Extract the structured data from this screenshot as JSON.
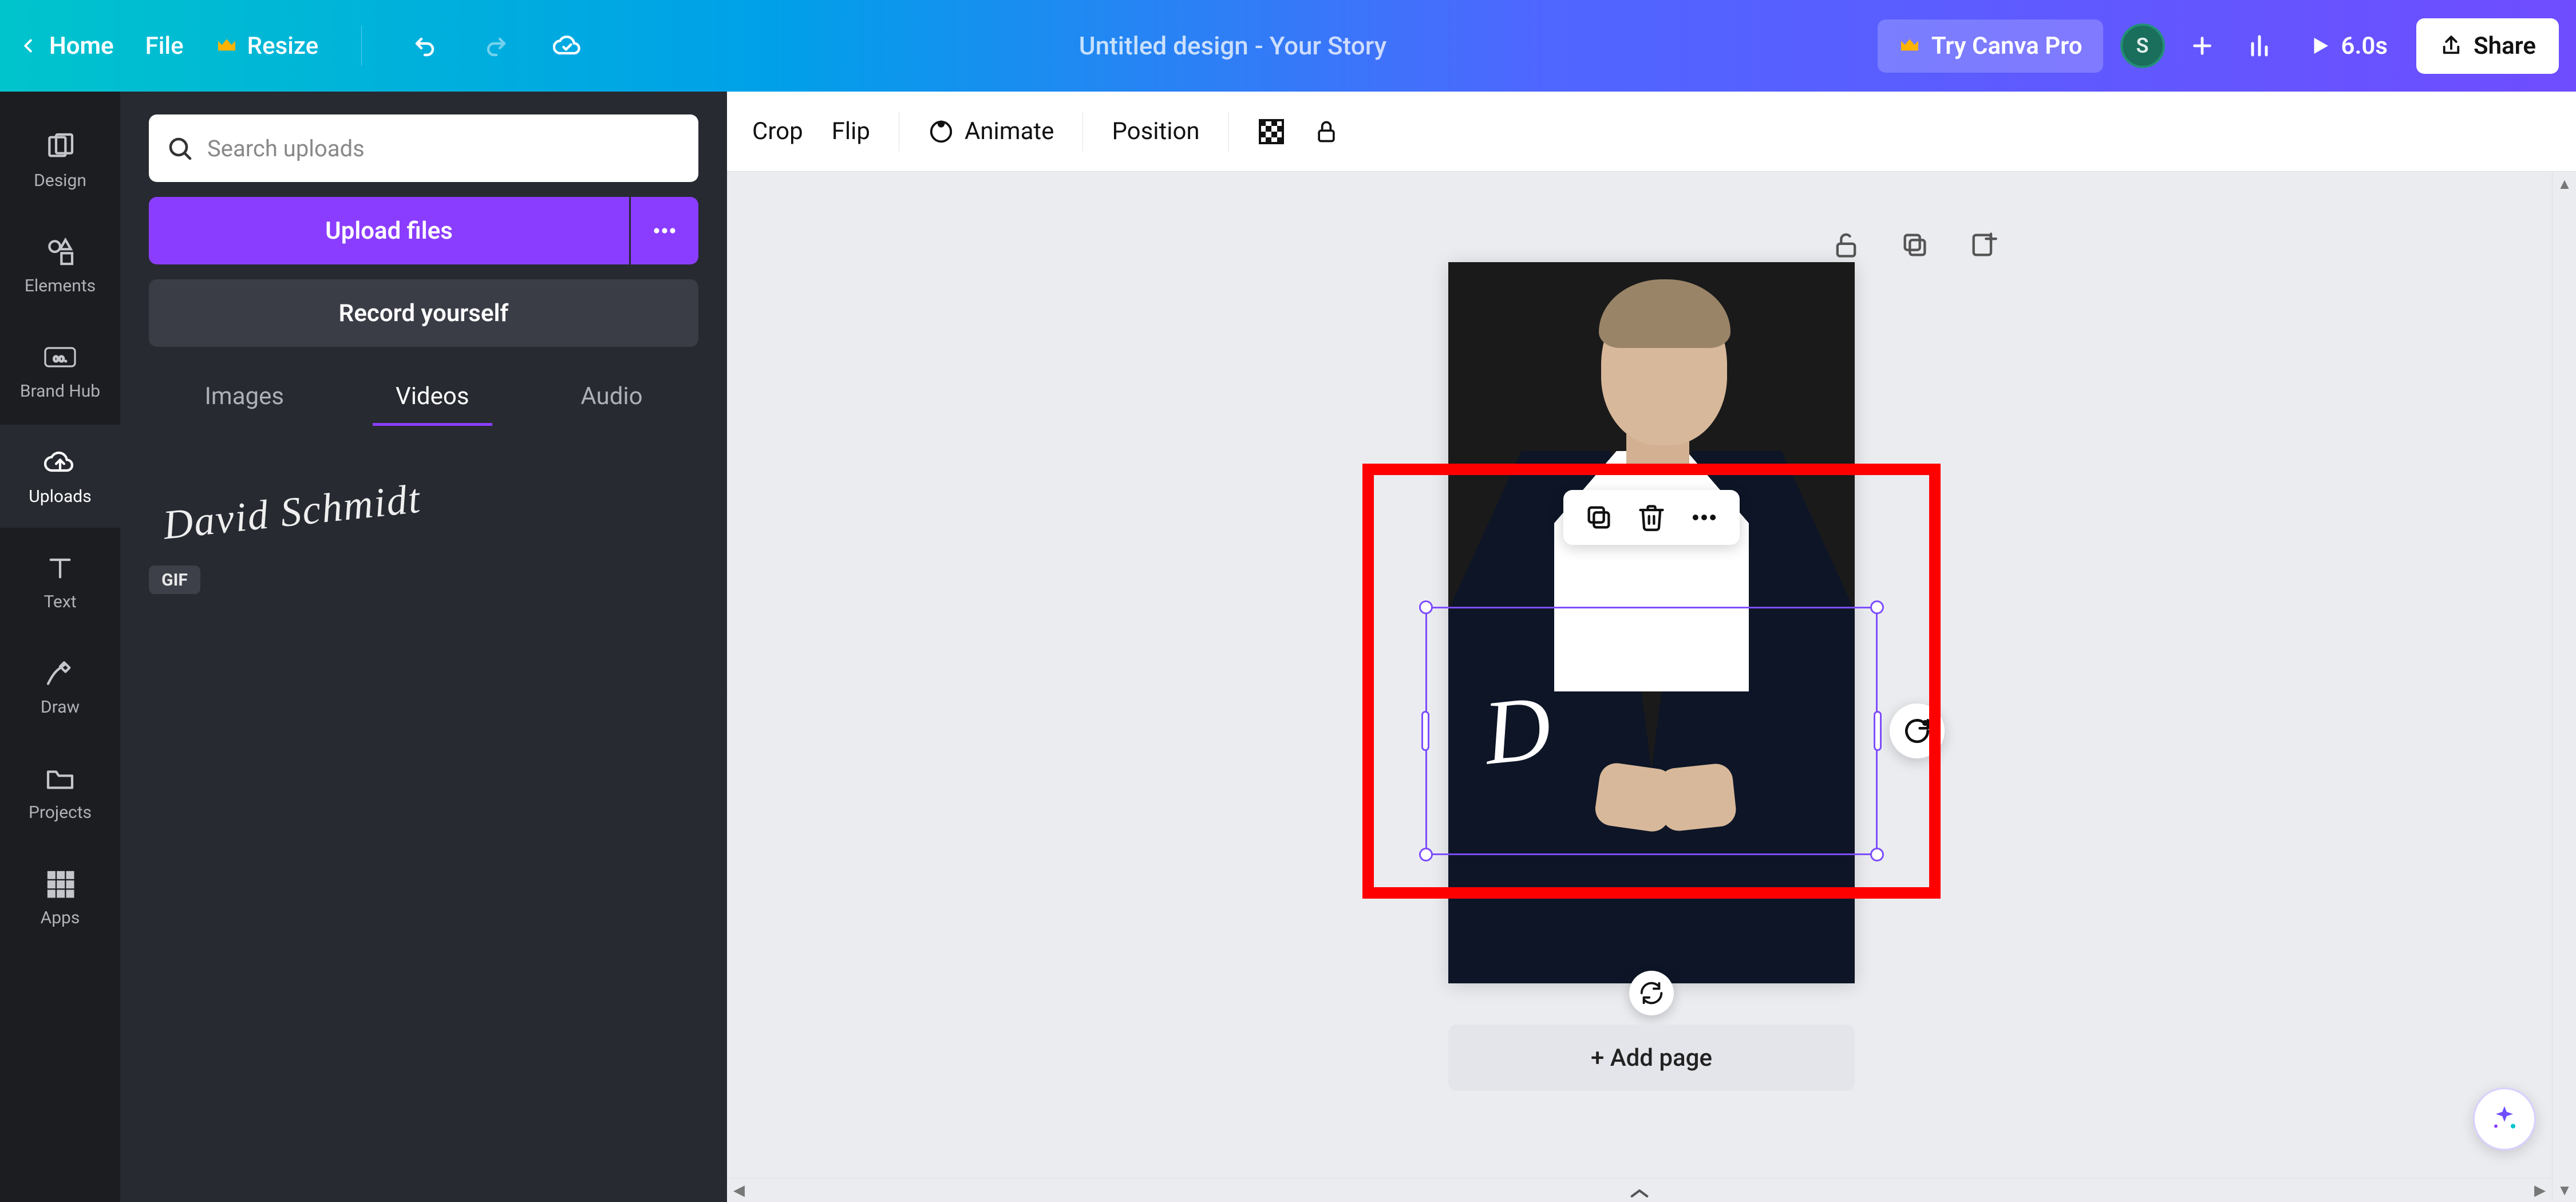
{
  "topbar": {
    "home": "Home",
    "file": "File",
    "resize": "Resize",
    "title": "Untitled design - Your Story",
    "pro": "Try Canva Pro",
    "avatar_initial": "S",
    "duration": "6.0s",
    "share": "Share"
  },
  "rail": {
    "design": "Design",
    "elements": "Elements",
    "brandhub": "Brand Hub",
    "uploads": "Uploads",
    "text": "Text",
    "draw": "Draw",
    "projects": "Projects",
    "apps": "Apps"
  },
  "panel": {
    "search_placeholder": "Search uploads",
    "upload": "Upload files",
    "record": "Record yourself",
    "tabs": {
      "images": "Images",
      "videos": "Videos",
      "audio": "Audio"
    },
    "item_signature": "David Schmidt",
    "gif_badge": "GIF"
  },
  "ctx": {
    "crop": "Crop",
    "flip": "Flip",
    "animate": "Animate",
    "position": "Position"
  },
  "canvas": {
    "add_page": "+ Add page",
    "selection_text": "D"
  }
}
